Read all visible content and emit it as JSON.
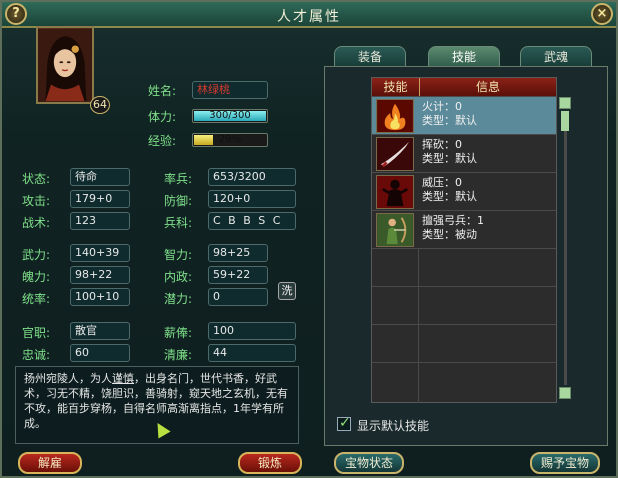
{
  "window": {
    "title": "人才属性",
    "help_label": "?",
    "close_label": "×"
  },
  "profile": {
    "level": "64",
    "name_label": "姓名:",
    "name": "林绿桃",
    "hp_label": "体力:",
    "hp_text": "300/300",
    "hp_fraction": 1.0,
    "exp_label": "经验:",
    "exp_text": "29%",
    "exp_fraction": 0.29
  },
  "stats": {
    "status_label": "状态:",
    "status": "待命",
    "troops_label": "率兵:",
    "troops": "653/3200",
    "attack_label": "攻击:",
    "attack": "179+0",
    "defense_label": "防御:",
    "defense": "120+0",
    "tactics_label": "战术:",
    "tactics": "123",
    "arms_label": "兵科:",
    "arms": "C B B S C",
    "might_label": "武力:",
    "might": "140+39",
    "intel_label": "智力:",
    "intel": "98+25",
    "charm_label": "魄力:",
    "charm": "98+22",
    "politics_label": "内政:",
    "politics": "59+22",
    "command_label": "统率:",
    "command": "100+10",
    "potential_label": "潜力:",
    "potential": "0",
    "wash_label": "洗",
    "office_label": "官职:",
    "office": "散官",
    "salary_label": "薪俸:",
    "salary": "100",
    "loyalty_label": "忠诚:",
    "loyalty": "60",
    "integrity_label": "清廉:",
    "integrity": "44"
  },
  "bio": {
    "before": "扬州宛陵人，为人",
    "highlight": "谨慎",
    "after": "，出身名门，世代书香，好武术，习无不精，饶胆识，善骑射，窥天地之玄机，无有不攻，能百步穿杨，自得名师高渐离指点，1年学有所成。"
  },
  "buttons": {
    "dismiss": "解雇",
    "train": "锻炼",
    "treasure_status": "宝物状态",
    "grant_treasure": "赐予宝物"
  },
  "tabs": [
    {
      "label": "装备",
      "active": false
    },
    {
      "label": "技能",
      "active": true
    },
    {
      "label": "武魂",
      "active": false
    }
  ],
  "skills": {
    "header_skill": "技能",
    "header_info": "信息",
    "items": [
      {
        "name_line": "火计：0",
        "type_line": "类型：默认",
        "icon": "fire-icon"
      },
      {
        "name_line": "挥砍：0",
        "type_line": "类型：默认",
        "icon": "sword-slash-icon"
      },
      {
        "name_line": "威压：0",
        "type_line": "类型：默认",
        "icon": "shadow-warrior-icon"
      },
      {
        "name_line": "擅强弓兵：1",
        "type_line": "类型：被动",
        "icon": "archer-icon"
      }
    ],
    "show_default_label": "显示默认技能",
    "show_default_checked": true
  }
}
